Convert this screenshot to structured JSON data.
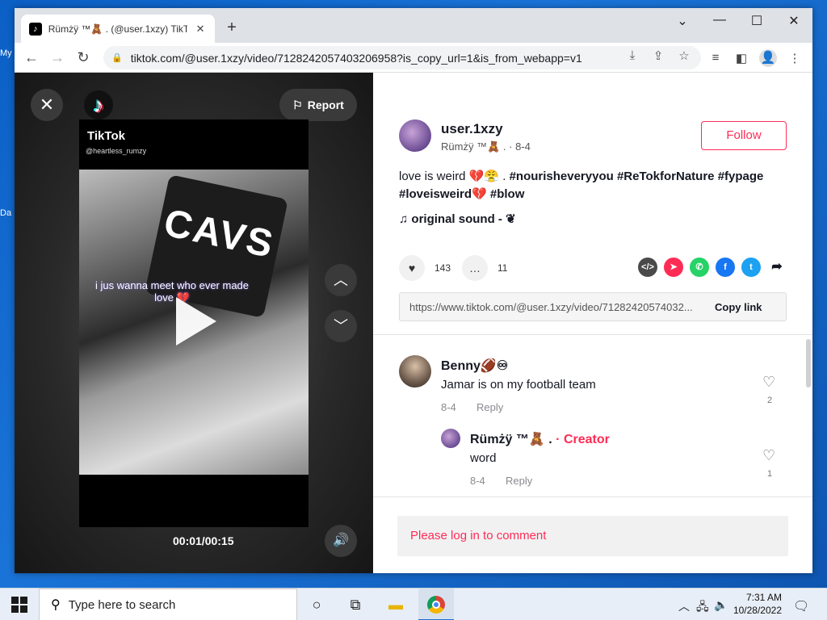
{
  "desktop": {
    "icons": [
      "My",
      "Da"
    ]
  },
  "browser": {
    "tab_title": "Rümżÿ ™🧸 . (@user.1xzy) TikTok",
    "tab_favicon": "tiktok-icon",
    "url": "tiktok.com/@user.1xzy/video/7128242057403206958?is_copy_url=1&is_from_webapp=v1",
    "new_tab": "+",
    "controls": {
      "chevron": "⌄",
      "minimize": "—",
      "maximize": "☐",
      "close": "✕"
    }
  },
  "video": {
    "watermark_brand": "TikTok",
    "watermark_handle": "@heartless_rumzy",
    "overlay_text": "i jus wanna meet who ever made love 💔",
    "shirt_text": "CAVS",
    "timecode": "00:01/00:15",
    "report_label": "Report"
  },
  "post": {
    "username": "user.1xzy",
    "display_name": "Rümżÿ ™🧸 .",
    "date": "8-4",
    "follow_label": "Follow",
    "caption_text": "love is weird 💔😤 . ",
    "hashtags_line1": "#nourisheveryyou #ReTokforNature #fypage",
    "hashtags_line2": "#loveisweird💔 #blow",
    "music": "original sound - ❦",
    "likes": "143",
    "comments_count": "11",
    "share_link": "https://www.tiktok.com/@user.1xzy/video/71282420574032...",
    "copy_link_label": "Copy link",
    "share_colors": {
      "embed": "#4a4a4a",
      "send": "#fe2c55",
      "whatsapp": "#25d366",
      "facebook": "#1877f2",
      "twitter": "#1da1f2"
    }
  },
  "comments": [
    {
      "name": "Benny🏈♾",
      "text": "Jamar is on my football team",
      "date": "8-4",
      "reply": "Reply",
      "likes": "2"
    },
    {
      "name": "Rümżÿ ™🧸 .",
      "badge": "· Creator",
      "text": "word",
      "date": "8-4",
      "reply": "Reply",
      "likes": "1"
    }
  ],
  "login_prompt": "Please log in to comment",
  "taskbar": {
    "search_placeholder": "Type here to search",
    "time": "7:31 AM",
    "date": "10/28/2022"
  }
}
